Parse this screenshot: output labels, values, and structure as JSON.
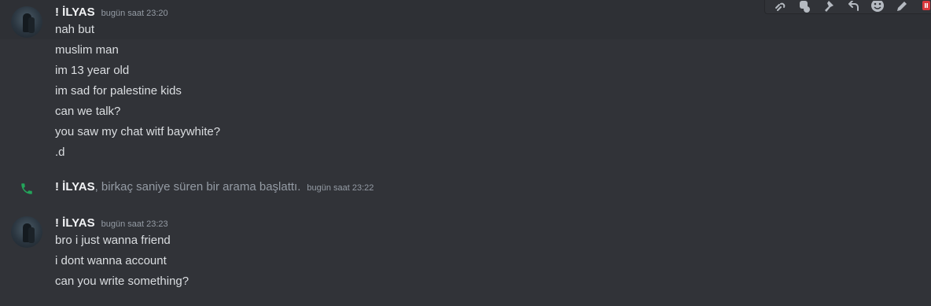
{
  "messages": [
    {
      "username": "!  İLYAS",
      "timestamp": "bugün saat 23:20",
      "lines": [
        "nah but",
        "muslim man",
        "im 13 year old",
        "im sad for palestine kids",
        "can we talk?",
        "you saw my chat witf baywhite?",
        ".d"
      ]
    },
    {
      "username": "!  İLYAS",
      "timestamp": "bugün saat 23:23",
      "lines": [
        "bro i just wanna friend",
        "i dont wanna account",
        "can you write something?"
      ]
    }
  ],
  "call": {
    "username": "!  İLYAS",
    "text": ", birkaç saniye süren bir arama başlattı.",
    "timestamp": "bugün saat 23:22"
  },
  "toolbar": {
    "icons": [
      "link-icon",
      "thread-icon",
      "pin-icon",
      "reply-icon",
      "emoji-icon",
      "edit-icon",
      "more-icon"
    ]
  },
  "colors": {
    "background": "#313338",
    "call_green": "#23a55a",
    "danger_red": "#da373c"
  }
}
